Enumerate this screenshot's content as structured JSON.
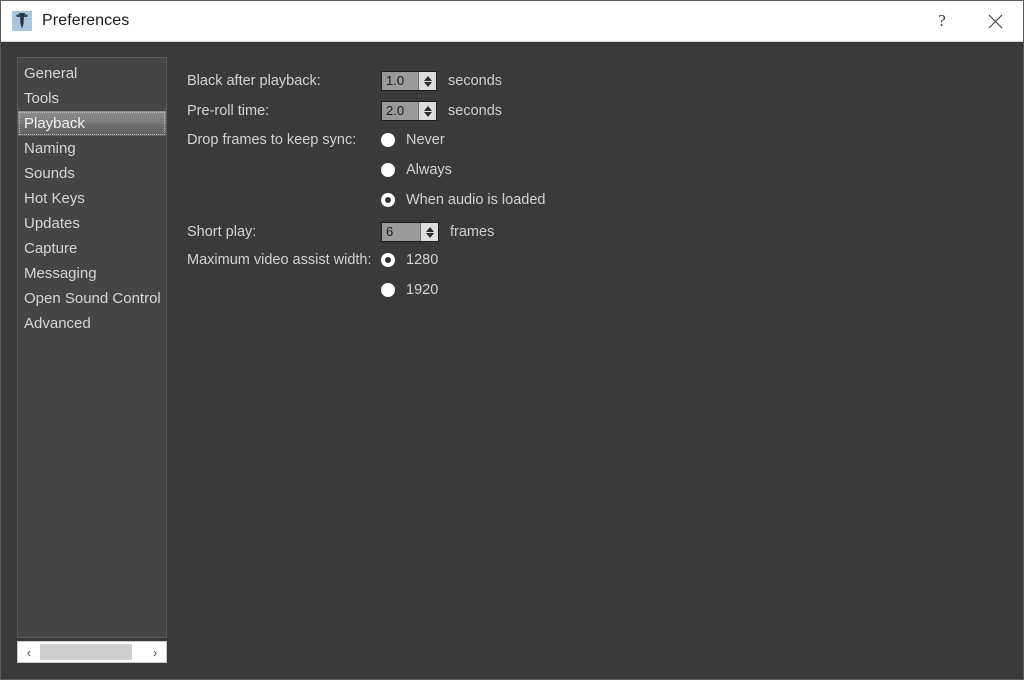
{
  "window": {
    "title": "Preferences",
    "icon": "app-icon",
    "help_label": "?",
    "close_label": "✕"
  },
  "sidebar": {
    "items": [
      {
        "label": "General",
        "selected": false
      },
      {
        "label": "Tools",
        "selected": false
      },
      {
        "label": "Playback",
        "selected": true
      },
      {
        "label": "Naming",
        "selected": false
      },
      {
        "label": "Sounds",
        "selected": false
      },
      {
        "label": "Hot Keys",
        "selected": false
      },
      {
        "label": "Updates",
        "selected": false
      },
      {
        "label": "Capture",
        "selected": false
      },
      {
        "label": "Messaging",
        "selected": false
      },
      {
        "label": "Open Sound Control",
        "selected": false
      },
      {
        "label": "Advanced",
        "selected": false
      }
    ],
    "scrollbar": {
      "left_arrow": "‹",
      "right_arrow": "›"
    }
  },
  "form": {
    "black_after_playback": {
      "label": "Black after playback:",
      "value": "1.0",
      "unit": "seconds"
    },
    "pre_roll_time": {
      "label": "Pre-roll time:",
      "value": "2.0",
      "unit": "seconds"
    },
    "drop_frames": {
      "label": "Drop frames to keep sync:",
      "options": [
        {
          "label": "Never",
          "selected": false
        },
        {
          "label": "Always",
          "selected": false
        },
        {
          "label": "When audio is loaded",
          "selected": true
        }
      ]
    },
    "short_play": {
      "label": "Short play:",
      "value": "6",
      "unit": "frames"
    },
    "max_video_assist_width": {
      "label": "Maximum video assist width:",
      "options": [
        {
          "label": "1280",
          "selected": true
        },
        {
          "label": "1920",
          "selected": false
        }
      ]
    }
  }
}
